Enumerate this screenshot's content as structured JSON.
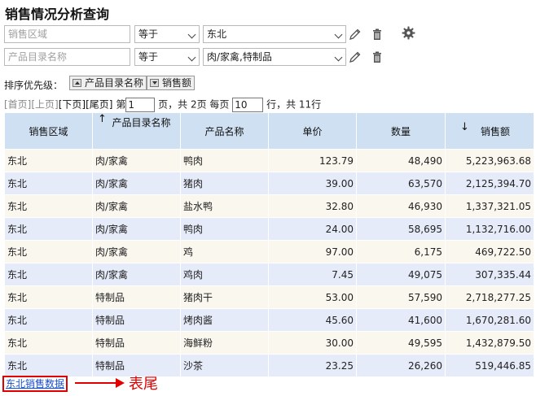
{
  "title": "销售情况分析查询",
  "filters": [
    {
      "field_placeholder": "销售区域",
      "operator": "等于",
      "value": "东北"
    },
    {
      "field_placeholder": "产品目录名称",
      "operator": "等于",
      "value": "肉/家禽,特制品"
    }
  ],
  "icons": {
    "edit": "pencil-icon",
    "delete": "trash-icon",
    "settings": "gear-icon"
  },
  "sort": {
    "label": "排序优先级：",
    "items": [
      {
        "label": "产品目录名称",
        "direction": "asc"
      },
      {
        "label": "销售额",
        "direction": "desc"
      }
    ]
  },
  "pager": {
    "first": "[首页]",
    "prev": "[上页]",
    "next": "[下页]",
    "last": "[尾页]",
    "page_prefix": "第",
    "page": "1",
    "page_suffix": "页，共 2页 每页",
    "page_size": "10",
    "total_text": "行，共 11行"
  },
  "table": {
    "headers": [
      "销售区域",
      "产品目录名称",
      "产品名称",
      "单价",
      "数量",
      "销售额"
    ],
    "rows": [
      [
        "东北",
        "肉/家禽",
        "鸭肉",
        "123.79",
        "48,490",
        "5,223,963.68"
      ],
      [
        "东北",
        "肉/家禽",
        "猪肉",
        "39.00",
        "63,570",
        "2,125,394.70"
      ],
      [
        "东北",
        "肉/家禽",
        "盐水鸭",
        "32.80",
        "46,930",
        "1,337,321.05"
      ],
      [
        "东北",
        "肉/家禽",
        "鸭肉",
        "24.00",
        "58,695",
        "1,132,716.00"
      ],
      [
        "东北",
        "肉/家禽",
        "鸡",
        "97.00",
        "6,175",
        "469,722.50"
      ],
      [
        "东北",
        "肉/家禽",
        "鸡肉",
        "7.45",
        "49,075",
        "307,335.44"
      ],
      [
        "东北",
        "特制品",
        "猪肉干",
        "53.00",
        "57,590",
        "2,718,277.25"
      ],
      [
        "东北",
        "特制品",
        "烤肉酱",
        "45.60",
        "41,600",
        "1,670,281.60"
      ],
      [
        "东北",
        "特制品",
        "海鲜粉",
        "30.00",
        "49,595",
        "1,432,879.50"
      ],
      [
        "东北",
        "特制品",
        "沙茶",
        "23.25",
        "26,260",
        "519,446.85"
      ]
    ]
  },
  "footer": {
    "link": "东北销售数据",
    "annotation": "表尾"
  },
  "colors": {
    "header_bg": "#cfe0f2",
    "row_odd": "#faf7ef",
    "row_even": "#e6ebf9",
    "annotation": "#e00000",
    "link": "#1a4fcf"
  }
}
